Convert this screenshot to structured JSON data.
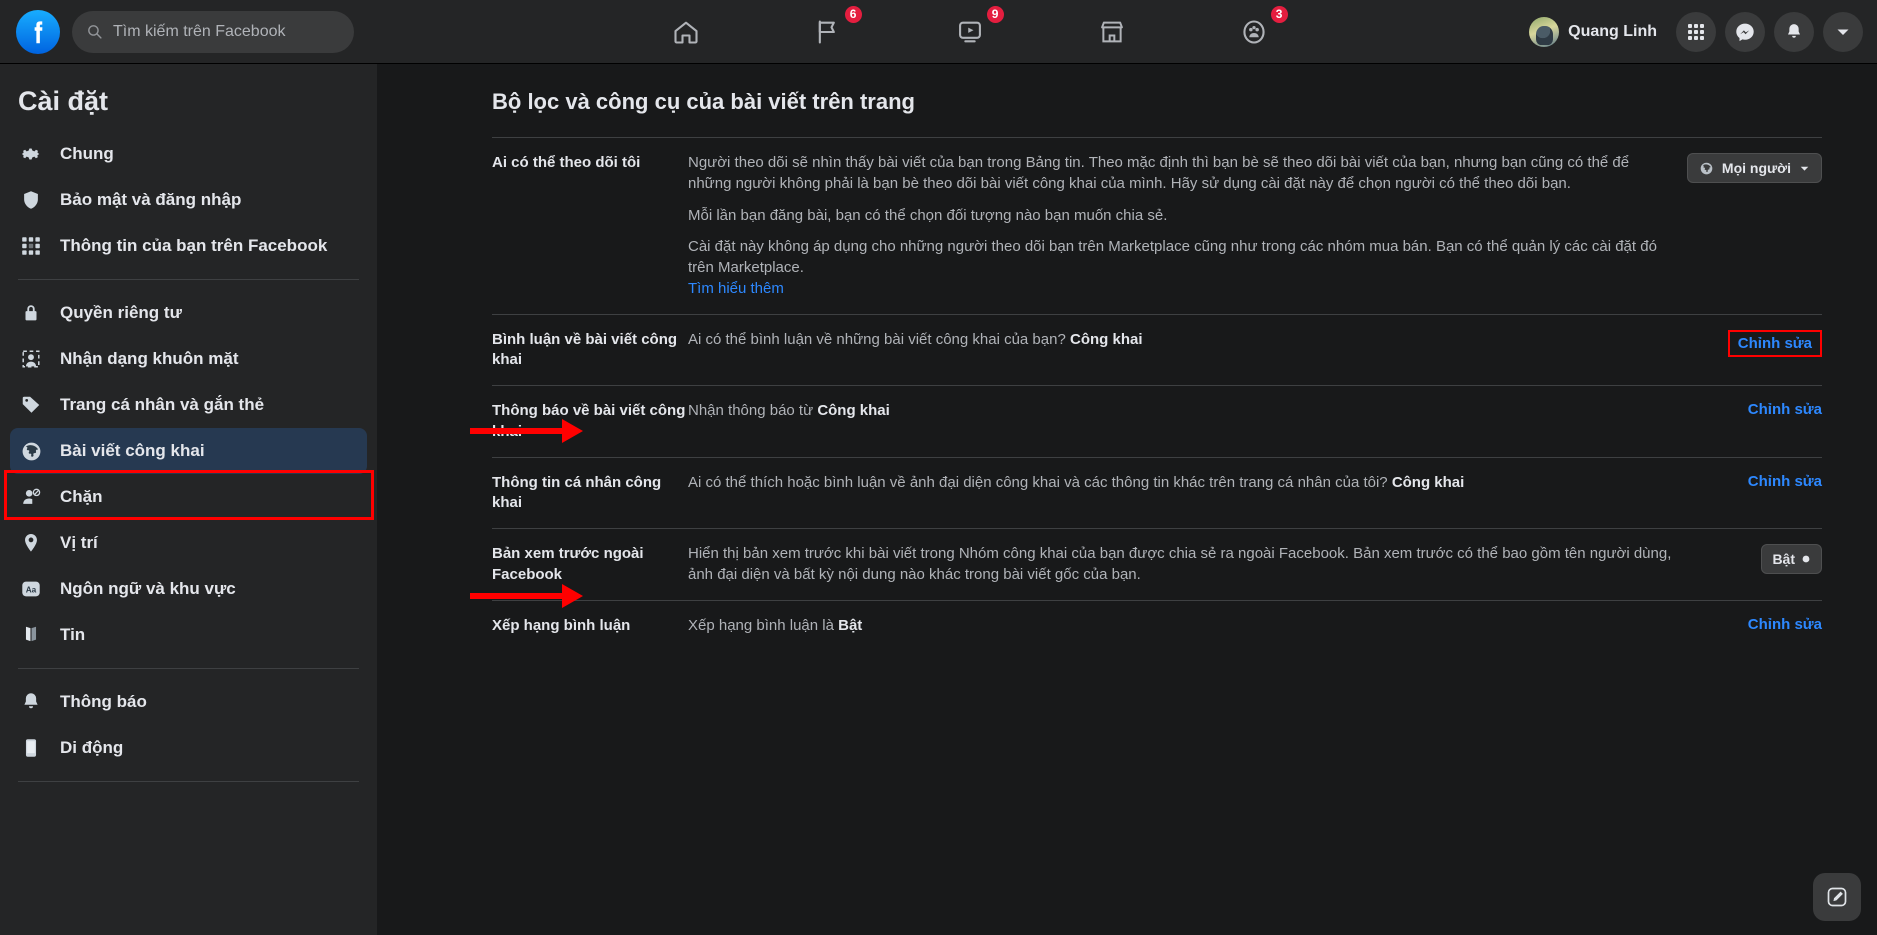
{
  "header": {
    "logo": "facebook-logo",
    "search": {
      "placeholder": "Tìm kiếm trên Facebook",
      "value": ""
    },
    "nav": [
      {
        "name": "home",
        "icon": "home-icon",
        "badge": ""
      },
      {
        "name": "pages",
        "icon": "flag-icon",
        "badge": "6"
      },
      {
        "name": "watch",
        "icon": "video-icon",
        "badge": "9"
      },
      {
        "name": "marketplace",
        "icon": "store-icon",
        "badge": ""
      },
      {
        "name": "groups",
        "icon": "groups-icon",
        "badge": "3"
      }
    ],
    "profile_name": "Quang Linh",
    "right_buttons": [
      {
        "name": "menu-grid",
        "icon": "grid-icon"
      },
      {
        "name": "messenger",
        "icon": "messenger-icon"
      },
      {
        "name": "notifications",
        "icon": "bell-icon"
      },
      {
        "name": "account",
        "icon": "chevron-down-icon"
      }
    ]
  },
  "sidebar": {
    "title": "Cài đặt",
    "groups": [
      {
        "items": [
          {
            "label": "Chung",
            "icon": "gear-icon",
            "active": false
          },
          {
            "label": "Bảo mật và đăng nhập",
            "icon": "shield-icon",
            "active": false
          },
          {
            "label": "Thông tin của bạn trên Facebook",
            "icon": "grid-icon",
            "active": false
          }
        ]
      },
      {
        "items": [
          {
            "label": "Quyền riêng tư",
            "icon": "lock-icon",
            "active": false
          },
          {
            "label": "Nhận dạng khuôn mặt",
            "icon": "face-icon",
            "active": false
          },
          {
            "label": "Trang cá nhân và gắn thẻ",
            "icon": "tag-icon",
            "active": false
          },
          {
            "label": "Bài viết công khai",
            "icon": "globe-icon",
            "active": true
          },
          {
            "label": "Chặn",
            "icon": "block-user-icon",
            "active": false
          },
          {
            "label": "Vị trí",
            "icon": "pin-icon",
            "active": false
          },
          {
            "label": "Ngôn ngữ và khu vực",
            "icon": "language-icon",
            "active": false
          },
          {
            "label": "Tin",
            "icon": "book-icon",
            "active": false
          }
        ]
      },
      {
        "items": [
          {
            "label": "Thông báo",
            "icon": "bell-icon",
            "active": false
          },
          {
            "label": "Di động",
            "icon": "mobile-icon",
            "active": false
          }
        ]
      }
    ]
  },
  "main": {
    "title": "Bộ lọc và công cụ của bài viết trên trang",
    "rows": [
      {
        "label": "Ai có thể theo dõi tôi",
        "paragraphs": [
          "Người theo dõi sẽ nhìn thấy bài viết của bạn trong Bảng tin. Theo mặc định thì bạn bè sẽ theo dõi bài viết của bạn, nhưng bạn cũng có thể để những người không phải là bạn bè theo dõi bài viết công khai của mình. Hãy sử dụng cài đặt này để chọn người có thể theo dõi bạn.",
          "Mỗi lần bạn đăng bài, bạn có thể chọn đối tượng nào bạn muốn chia sẻ.",
          "Cài đặt này không áp dụng cho những người theo dõi bạn trên Marketplace cũng như trong các nhóm mua bán. Bạn có thể quản lý các cài đặt đó trên Marketplace."
        ],
        "link": "Tìm hiểu thêm",
        "action": {
          "type": "dropdown",
          "label": "Mọi người",
          "icon": "globe-icon"
        }
      },
      {
        "label": "Bình luận về bài viết công khai",
        "text_prefix": "Ai có thể bình luận về những bài viết công khai của bạn? ",
        "text_bold": "Công khai",
        "action": {
          "type": "edit-boxed",
          "label": "Chỉnh sửa"
        }
      },
      {
        "label": "Thông báo về bài viết công khai",
        "text_prefix": "Nhận thông báo từ ",
        "text_bold": "Công khai",
        "action": {
          "type": "edit",
          "label": "Chỉnh sửa"
        }
      },
      {
        "label": "Thông tin cá nhân công khai",
        "text_prefix": "Ai có thể thích hoặc bình luận về ảnh đại diện công khai và các thông tin khác trên trang cá nhân của tôi? ",
        "text_bold": "Công khai",
        "action": {
          "type": "edit",
          "label": "Chỉnh sửa"
        }
      },
      {
        "label": "Bản xem trước ngoài Facebook",
        "text_prefix": "Hiển thị bản xem trước khi bài viết trong Nhóm công khai của bạn được chia sẻ ra ngoài Facebook. Bản xem trước có thể bao gồm tên người dùng, ảnh đại diện và bất kỳ nội dung nào khác trong bài viết gốc của bạn.",
        "text_bold": "",
        "action": {
          "type": "toggle",
          "label": "Bật"
        }
      },
      {
        "label": "Xếp hạng bình luận",
        "text_prefix": "Xếp hạng bình luận là ",
        "text_bold": "Bật",
        "action": {
          "type": "edit",
          "label": "Chỉnh sửa"
        }
      }
    ]
  },
  "annotations": {
    "box_color": "#ff0000",
    "arrows": [
      {
        "name": "arrow-to-comments-row",
        "target": "Bình luận về bài viết công khai"
      },
      {
        "name": "arrow-to-public-info-row",
        "target": "Thông tin cá nhân công khai"
      }
    ]
  },
  "fab": {
    "icon": "compose-icon"
  }
}
